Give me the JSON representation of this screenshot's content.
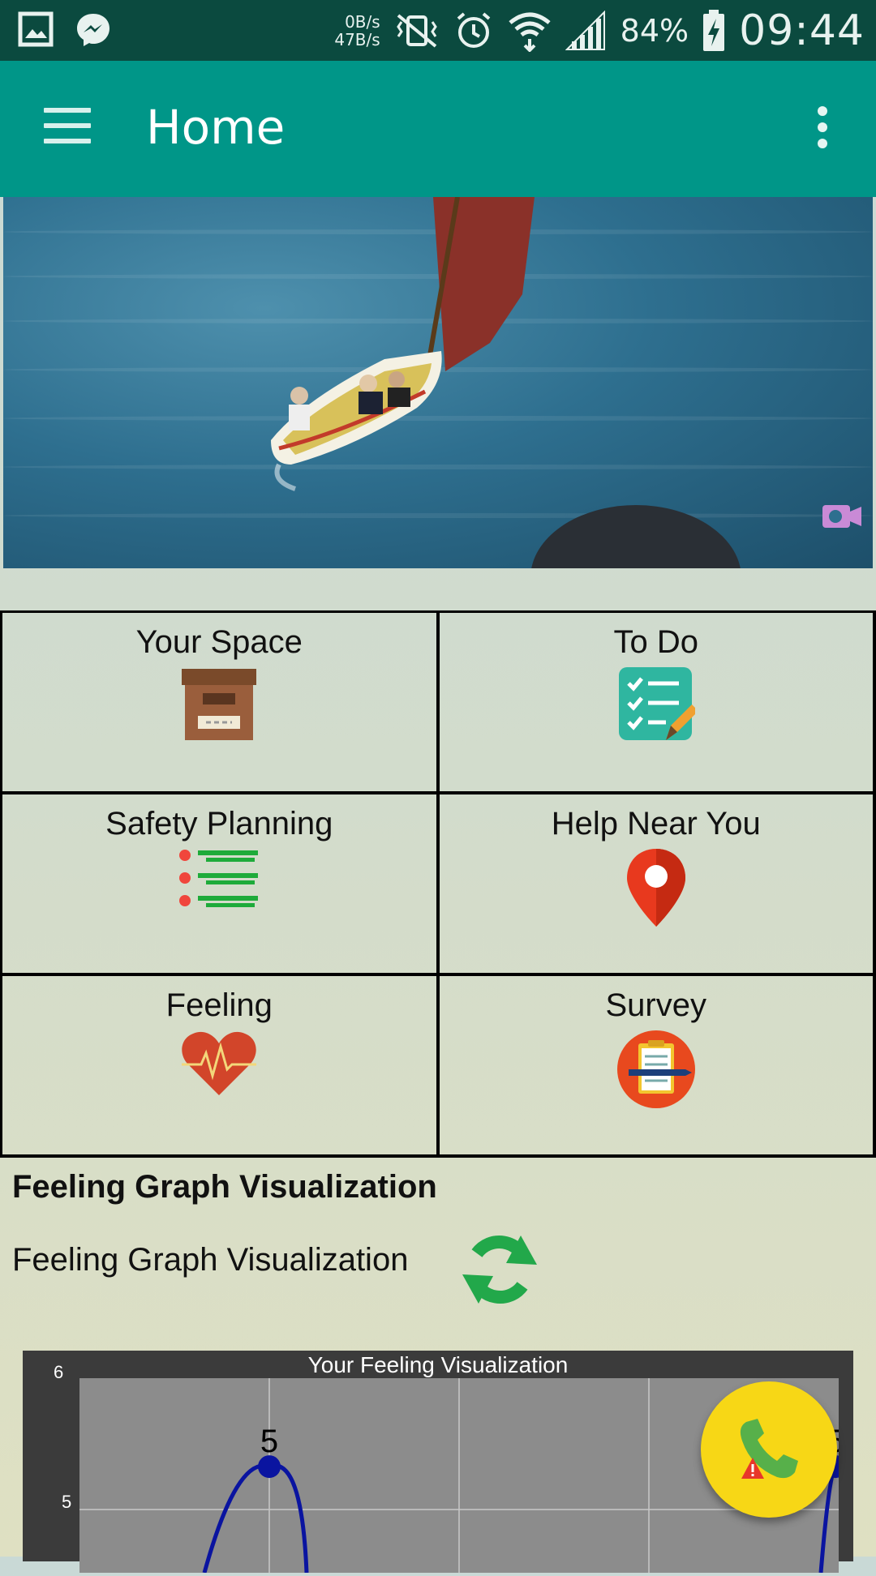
{
  "status_bar": {
    "net_down": "0B/s",
    "net_up": "47B/s",
    "battery": "84%",
    "time": "09:44"
  },
  "app_bar": {
    "title": "Home"
  },
  "tiles": [
    {
      "label": "Your Space",
      "icon": "archive-box-icon"
    },
    {
      "label": "To Do",
      "icon": "checklist-icon"
    },
    {
      "label": "Safety Planning",
      "icon": "list-icon"
    },
    {
      "label": "Help Near You",
      "icon": "map-pin-icon"
    },
    {
      "label": "Feeling",
      "icon": "heart-pulse-icon"
    },
    {
      "label": "Survey",
      "icon": "clipboard-icon"
    }
  ],
  "feeling_section": {
    "title": "Feeling Graph Visualization",
    "subtitle": "Feeling Graph Visualization"
  },
  "chart_data": {
    "type": "line",
    "title": "Your Feeling Visualization",
    "yticks": [
      "6",
      "5"
    ],
    "points": [
      {
        "x": 1,
        "y": 5,
        "label": "5"
      },
      {
        "x": 4,
        "y": 5,
        "label": "5"
      }
    ],
    "line_color": "#0a14a0",
    "grid": true
  },
  "colors": {
    "status_bar": "#0b4a3f",
    "app_bar": "#009688",
    "fab": "#f7d716"
  },
  "fab": {
    "icon": "emergency-call-icon"
  }
}
